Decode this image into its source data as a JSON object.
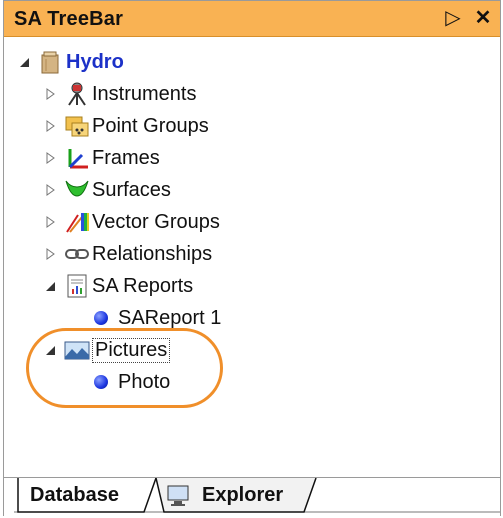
{
  "panel": {
    "title": "SA TreeBar",
    "buttons": {
      "pin": "▷",
      "close": "✕"
    }
  },
  "tree": {
    "root": {
      "label": "Hydro"
    },
    "items": [
      {
        "label": "Instruments"
      },
      {
        "label": "Point Groups"
      },
      {
        "label": "Frames"
      },
      {
        "label": "Surfaces"
      },
      {
        "label": "Vector Groups"
      },
      {
        "label": "Relationships"
      },
      {
        "label": "SA Reports"
      },
      {
        "label": "SAReport 1"
      },
      {
        "label": "Pictures"
      },
      {
        "label": "Photo"
      }
    ]
  },
  "tabs": [
    {
      "label": "Database"
    },
    {
      "label": "Explorer"
    }
  ],
  "colors": {
    "titlebar": "#f9b253",
    "highlight": "#f08f2a",
    "root_text": "#1c31c8"
  }
}
